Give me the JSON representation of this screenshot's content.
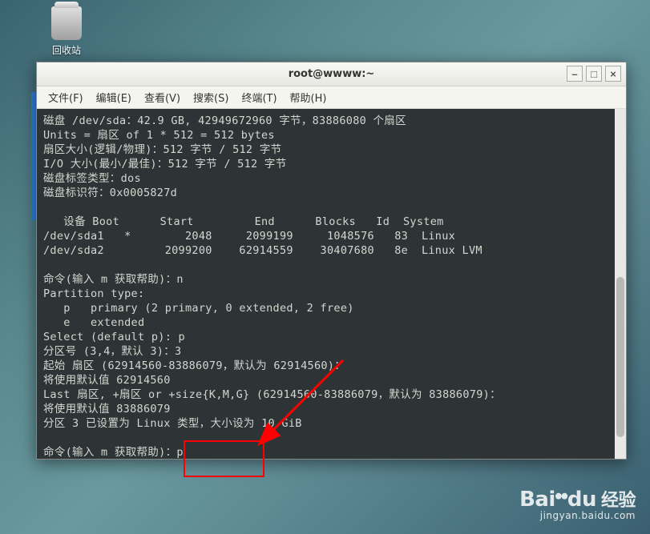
{
  "desktop": {
    "trash_label": "回收站"
  },
  "window": {
    "title": "root@wwww:~"
  },
  "menubar": {
    "file": "文件(F)",
    "edit": "编辑(E)",
    "view": "查看(V)",
    "search": "搜索(S)",
    "terminal": "终端(T)",
    "help": "帮助(H)"
  },
  "window_controls": {
    "minimize": "–",
    "maximize": "□",
    "close": "×"
  },
  "terminal": {
    "lines": [
      "磁盘 /dev/sda：42.9 GB, 42949672960 字节，83886080 个扇区",
      "Units = 扇区 of 1 * 512 = 512 bytes",
      "扇区大小(逻辑/物理)：512 字节 / 512 字节",
      "I/O 大小(最小/最佳)：512 字节 / 512 字节",
      "磁盘标签类型：dos",
      "磁盘标识符：0x0005827d",
      "",
      "   设备 Boot      Start         End      Blocks   Id  System",
      "/dev/sda1   *        2048     2099199     1048576   83  Linux",
      "/dev/sda2         2099200    62914559    30407680   8e  Linux LVM",
      "",
      "命令(输入 m 获取帮助)：n",
      "Partition type:",
      "   p   primary (2 primary, 0 extended, 2 free)",
      "   e   extended",
      "Select (default p): p",
      "分区号 (3,4，默认 3)：3",
      "起始 扇区 (62914560-83886079，默认为 62914560)：",
      "将使用默认值 62914560",
      "Last 扇区, +扇区 or +size{K,M,G} (62914560-83886079，默认为 83886079)：",
      "将使用默认值 83886079",
      "分区 3 已设置为 Linux 类型，大小设为 10 GiB",
      "",
      "命令(输入 m 获取帮助)：p"
    ]
  },
  "watermark": {
    "logo": "Bai",
    "logo2": "du",
    "chn": "经验",
    "url": "jingyan.baidu.com"
  }
}
